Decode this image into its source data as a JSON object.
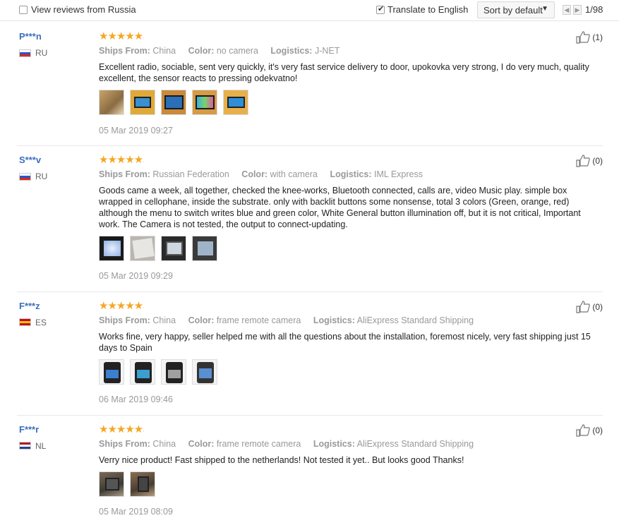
{
  "toolbar": {
    "view_russia_label": "View reviews from Russia",
    "view_russia_checked": false,
    "translate_label": "Translate to English",
    "translate_checked": true,
    "sort_label": "Sort by default",
    "prev_icon": "chevron-left-icon",
    "next_icon": "chevron-right-icon",
    "page_indicator": "1/98"
  },
  "labels": {
    "ships_from": "Ships From:",
    "color": "Color:",
    "logistics": "Logistics:"
  },
  "reviews": [
    {
      "user": "P***n",
      "country": "RU",
      "rating": 5,
      "stars": "★★★★★",
      "ships_from": "China",
      "color": "no camera",
      "logistics": "J-NET",
      "text": "Excellent radio, sociable, sent very quickly, it's very fast service delivery to door, upokovka very strong, I do very much, quality excellent, the sensor reacts to pressing odekvatno!",
      "photo_count": 5,
      "date": "05 Mar 2019 09:27",
      "likes": "(1)"
    },
    {
      "user": "S***v",
      "country": "RU",
      "rating": 5,
      "stars": "★★★★★",
      "ships_from": "Russian Federation",
      "color": "with camera",
      "logistics": "IML Express",
      "text": "Goods came a week, all together, checked the knee-works, Bluetooth connected, calls are, video Music play. simple box wrapped in cellophane, inside the substrate. only with backlit buttons some nonsense, total 3 colors (Green, orange, red) although the menu to switch writes blue and green color, White General button illumination off, but it is not critical, Important work. The Camera is not tested, the output to connect-updating.",
      "photo_count": 4,
      "date": "05 Mar 2019 09:29",
      "likes": "(0)"
    },
    {
      "user": "F***z",
      "country": "ES",
      "rating": 5,
      "stars": "★★★★★",
      "ships_from": "China",
      "color": "frame remote camera",
      "logistics": "AliExpress Standard Shipping",
      "text": "Works fine, very happy, seller helped me with all the questions about the installation, foremost nicely, very fast shipping just 15 days to Spain",
      "photo_count": 4,
      "date": "06 Mar 2019 09:46",
      "likes": "(0)"
    },
    {
      "user": "F***r",
      "country": "NL",
      "rating": 5,
      "stars": "★★★★★",
      "ships_from": "China",
      "color": "frame remote camera",
      "logistics": "AliExpress Standard Shipping",
      "text": "Verry nice product! Fast shipped to the netherlands! Not tested it yet.. But looks good Thanks!",
      "photo_count": 2,
      "date": "05 Mar 2019 08:09",
      "likes": "(0)"
    }
  ],
  "colors": {
    "username": "#3a6fbe",
    "star": "#f5a623",
    "muted": "#999999",
    "body_text": "#222222"
  }
}
